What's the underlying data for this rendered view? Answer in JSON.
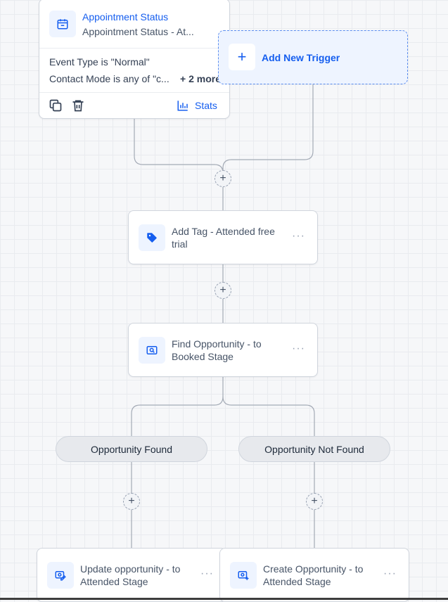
{
  "trigger": {
    "title": "Appointment Status",
    "subtitle": "Appointment Status - At...",
    "condition_1": "Event Type is \"Normal\"",
    "condition_2": "Contact Mode is any of \"c...",
    "more": "+ 2 more",
    "stats_label": "Stats",
    "icon": "calendar-icon"
  },
  "add_trigger": {
    "label": "Add New Trigger",
    "icon": "plus-icon"
  },
  "actions": [
    {
      "label": "Add Tag - Attended free trial",
      "icon": "tag-icon",
      "menu": "···"
    },
    {
      "label": "Find Opportunity - to Booked Stage",
      "icon": "find-opportunity-icon",
      "menu": "···"
    },
    {
      "label": "Update opportunity - to Attended Stage",
      "icon": "update-opportunity-icon",
      "menu": "···"
    },
    {
      "label": "Create Opportunity - to Attended Stage",
      "icon": "create-opportunity-icon",
      "menu": "···"
    }
  ],
  "branches": [
    {
      "label": "Opportunity Found"
    },
    {
      "label": "Opportunity Not Found"
    }
  ],
  "plus_symbol": "+",
  "colors": {
    "accent": "#155eef",
    "accent_bg": "#eef4ff",
    "connector": "#98a2b3"
  }
}
